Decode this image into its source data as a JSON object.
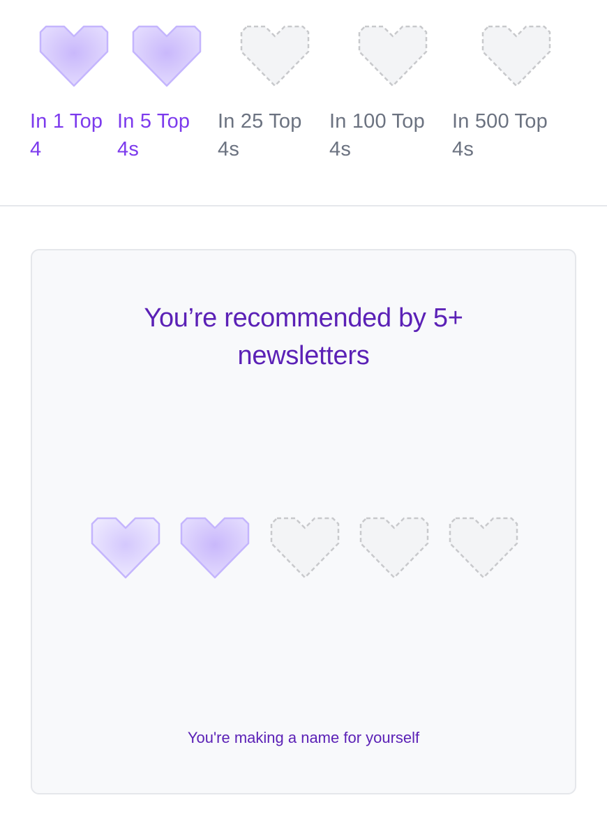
{
  "palette": {
    "accent": "#7c3aed",
    "title_color": "#5b21b6",
    "locked_text": "#6b7280",
    "heart_earned_fill": "#ddd6fe",
    "heart_earned_stroke": "#c4b5fd",
    "heart_locked_fill": "#f3f4f6",
    "heart_locked_stroke": "#c8c9cc",
    "card_background": "#f8f9fb"
  },
  "milestones": [
    {
      "label_line1": "In 1 Top",
      "label_line2": "4",
      "state": "earned",
      "icon": "heart-icon"
    },
    {
      "label_line1": "In 5 Top",
      "label_line2": "4s",
      "state": "earned",
      "icon": "heart-icon"
    },
    {
      "label_line1": "In 25 Top",
      "label_line2": "4s",
      "state": "locked",
      "icon": "heart-outline-dashed-icon"
    },
    {
      "label_line1": "In 100 Top",
      "label_line2": "4s",
      "state": "locked",
      "icon": "heart-outline-dashed-icon"
    },
    {
      "label_line1": "In 500 Top",
      "label_line2": "4s",
      "state": "locked",
      "icon": "heart-outline-dashed-icon"
    }
  ],
  "card": {
    "title_line1": "You’re recommended by 5+",
    "title_line2": "newsletters",
    "caption": "You're making a name for yourself",
    "hearts": [
      {
        "state": "earned",
        "icon": "heart-icon"
      },
      {
        "state": "earned",
        "icon": "heart-icon"
      },
      {
        "state": "locked",
        "icon": "heart-outline-dashed-icon"
      },
      {
        "state": "locked",
        "icon": "heart-outline-dashed-icon"
      },
      {
        "state": "locked",
        "icon": "heart-outline-dashed-icon"
      }
    ]
  }
}
